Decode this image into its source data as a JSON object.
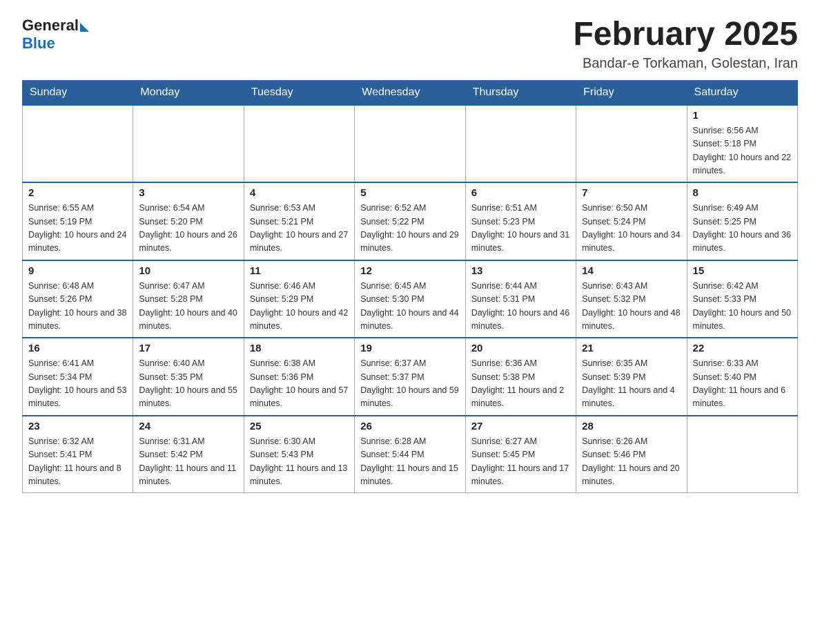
{
  "header": {
    "logo_general": "General",
    "logo_blue": "Blue",
    "month_title": "February 2025",
    "location": "Bandar-e Torkaman, Golestan, Iran"
  },
  "weekdays": [
    "Sunday",
    "Monday",
    "Tuesday",
    "Wednesday",
    "Thursday",
    "Friday",
    "Saturday"
  ],
  "weeks": [
    [
      {
        "day": "",
        "info": ""
      },
      {
        "day": "",
        "info": ""
      },
      {
        "day": "",
        "info": ""
      },
      {
        "day": "",
        "info": ""
      },
      {
        "day": "",
        "info": ""
      },
      {
        "day": "",
        "info": ""
      },
      {
        "day": "1",
        "info": "Sunrise: 6:56 AM\nSunset: 5:18 PM\nDaylight: 10 hours and 22 minutes."
      }
    ],
    [
      {
        "day": "2",
        "info": "Sunrise: 6:55 AM\nSunset: 5:19 PM\nDaylight: 10 hours and 24 minutes."
      },
      {
        "day": "3",
        "info": "Sunrise: 6:54 AM\nSunset: 5:20 PM\nDaylight: 10 hours and 26 minutes."
      },
      {
        "day": "4",
        "info": "Sunrise: 6:53 AM\nSunset: 5:21 PM\nDaylight: 10 hours and 27 minutes."
      },
      {
        "day": "5",
        "info": "Sunrise: 6:52 AM\nSunset: 5:22 PM\nDaylight: 10 hours and 29 minutes."
      },
      {
        "day": "6",
        "info": "Sunrise: 6:51 AM\nSunset: 5:23 PM\nDaylight: 10 hours and 31 minutes."
      },
      {
        "day": "7",
        "info": "Sunrise: 6:50 AM\nSunset: 5:24 PM\nDaylight: 10 hours and 34 minutes."
      },
      {
        "day": "8",
        "info": "Sunrise: 6:49 AM\nSunset: 5:25 PM\nDaylight: 10 hours and 36 minutes."
      }
    ],
    [
      {
        "day": "9",
        "info": "Sunrise: 6:48 AM\nSunset: 5:26 PM\nDaylight: 10 hours and 38 minutes."
      },
      {
        "day": "10",
        "info": "Sunrise: 6:47 AM\nSunset: 5:28 PM\nDaylight: 10 hours and 40 minutes."
      },
      {
        "day": "11",
        "info": "Sunrise: 6:46 AM\nSunset: 5:29 PM\nDaylight: 10 hours and 42 minutes."
      },
      {
        "day": "12",
        "info": "Sunrise: 6:45 AM\nSunset: 5:30 PM\nDaylight: 10 hours and 44 minutes."
      },
      {
        "day": "13",
        "info": "Sunrise: 6:44 AM\nSunset: 5:31 PM\nDaylight: 10 hours and 46 minutes."
      },
      {
        "day": "14",
        "info": "Sunrise: 6:43 AM\nSunset: 5:32 PM\nDaylight: 10 hours and 48 minutes."
      },
      {
        "day": "15",
        "info": "Sunrise: 6:42 AM\nSunset: 5:33 PM\nDaylight: 10 hours and 50 minutes."
      }
    ],
    [
      {
        "day": "16",
        "info": "Sunrise: 6:41 AM\nSunset: 5:34 PM\nDaylight: 10 hours and 53 minutes."
      },
      {
        "day": "17",
        "info": "Sunrise: 6:40 AM\nSunset: 5:35 PM\nDaylight: 10 hours and 55 minutes."
      },
      {
        "day": "18",
        "info": "Sunrise: 6:38 AM\nSunset: 5:36 PM\nDaylight: 10 hours and 57 minutes."
      },
      {
        "day": "19",
        "info": "Sunrise: 6:37 AM\nSunset: 5:37 PM\nDaylight: 10 hours and 59 minutes."
      },
      {
        "day": "20",
        "info": "Sunrise: 6:36 AM\nSunset: 5:38 PM\nDaylight: 11 hours and 2 minutes."
      },
      {
        "day": "21",
        "info": "Sunrise: 6:35 AM\nSunset: 5:39 PM\nDaylight: 11 hours and 4 minutes."
      },
      {
        "day": "22",
        "info": "Sunrise: 6:33 AM\nSunset: 5:40 PM\nDaylight: 11 hours and 6 minutes."
      }
    ],
    [
      {
        "day": "23",
        "info": "Sunrise: 6:32 AM\nSunset: 5:41 PM\nDaylight: 11 hours and 8 minutes."
      },
      {
        "day": "24",
        "info": "Sunrise: 6:31 AM\nSunset: 5:42 PM\nDaylight: 11 hours and 11 minutes."
      },
      {
        "day": "25",
        "info": "Sunrise: 6:30 AM\nSunset: 5:43 PM\nDaylight: 11 hours and 13 minutes."
      },
      {
        "day": "26",
        "info": "Sunrise: 6:28 AM\nSunset: 5:44 PM\nDaylight: 11 hours and 15 minutes."
      },
      {
        "day": "27",
        "info": "Sunrise: 6:27 AM\nSunset: 5:45 PM\nDaylight: 11 hours and 17 minutes."
      },
      {
        "day": "28",
        "info": "Sunrise: 6:26 AM\nSunset: 5:46 PM\nDaylight: 11 hours and 20 minutes."
      },
      {
        "day": "",
        "info": ""
      }
    ]
  ]
}
